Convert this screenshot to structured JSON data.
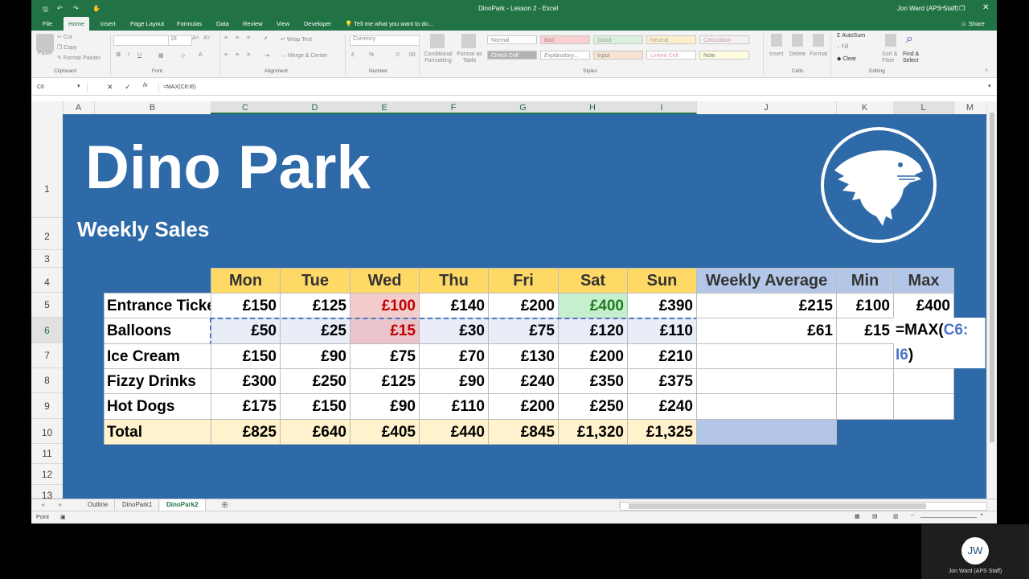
{
  "window": {
    "title": "DinoPark - Lesson 2 - Excel",
    "user": "Jon Ward (APS Staff)",
    "share_label": "Share"
  },
  "ribbon_tabs": [
    "File",
    "Home",
    "Insert",
    "Page Layout",
    "Formulas",
    "Data",
    "Review",
    "View",
    "Developer"
  ],
  "tell_me": "Tell me what you want to do...",
  "ribbon": {
    "clipboard": {
      "paste": "Paste",
      "cut": "Cut",
      "copy": "Copy",
      "format_painter": "Format Painter",
      "group": "Clipboard"
    },
    "font": {
      "size": "18",
      "group": "Font"
    },
    "alignment": {
      "wrap": "Wrap Text",
      "merge": "Merge & Center",
      "group": "Alignment"
    },
    "number": {
      "format": "Currency",
      "group": "Number"
    },
    "styles": {
      "conditional": "Conditional Formatting",
      "format_table": "Format as Table",
      "cells": [
        "Normal",
        "Bad",
        "Good",
        "Neutral",
        "Calculation",
        "Check Cell",
        "Explanatory...",
        "Input",
        "Linked Cell",
        "Note"
      ],
      "group": "Styles"
    },
    "cells": {
      "insert": "Insert",
      "delete": "Delete",
      "format": "Format",
      "group": "Cells"
    },
    "editing": {
      "autosum": "AutoSum",
      "fill": "Fill",
      "clear": "Clear",
      "sort": "Sort & Filter",
      "find": "Find & Select",
      "group": "Editing"
    }
  },
  "formula_bar": {
    "name_box": "C6",
    "formula": "=MAX(C6:I6)"
  },
  "columns": [
    "A",
    "B",
    "C",
    "D",
    "E",
    "F",
    "G",
    "H",
    "I",
    "J",
    "K",
    "L",
    "M"
  ],
  "rows": [
    "1",
    "2",
    "3",
    "4",
    "5",
    "6",
    "7",
    "8",
    "9",
    "10",
    "11",
    "12",
    "13"
  ],
  "sheet": {
    "title": "Dino Park",
    "subtitle": "Weekly Sales",
    "headers": [
      "Mon",
      "Tue",
      "Wed",
      "Thu",
      "Fri",
      "Sat",
      "Sun"
    ],
    "stat_headers": [
      "Weekly Average",
      "Min",
      "Max"
    ],
    "data_rows": [
      {
        "label": "Entrance Ticket",
        "values": [
          "£150",
          "£125",
          "£100",
          "£140",
          "£200",
          "£400",
          "£390"
        ],
        "avg": "£215",
        "min": "£100",
        "max": "£400"
      },
      {
        "label": "Balloons",
        "values": [
          "£50",
          "£25",
          "£15",
          "£30",
          "£75",
          "£120",
          "£110"
        ],
        "avg": "£61",
        "min": "£15",
        "max": ""
      },
      {
        "label": "Ice Cream",
        "values": [
          "£150",
          "£90",
          "£75",
          "£70",
          "£130",
          "£200",
          "£210"
        ],
        "avg": "",
        "min": "",
        "max": ""
      },
      {
        "label": "Fizzy Drinks",
        "values": [
          "£300",
          "£250",
          "£125",
          "£90",
          "£240",
          "£350",
          "£375"
        ],
        "avg": "",
        "min": "",
        "max": ""
      },
      {
        "label": "Hot Dogs",
        "values": [
          "£175",
          "£150",
          "£90",
          "£110",
          "£200",
          "£250",
          "£240"
        ],
        "avg": "",
        "min": "",
        "max": ""
      }
    ],
    "total": {
      "label": "Total",
      "values": [
        "£825",
        "£640",
        "£405",
        "£440",
        "£845",
        "£1,320",
        "£1,325"
      ]
    },
    "editing_formula": {
      "prefix": "=MAX(",
      "ref_a": "C6:",
      "ref_b": "I6",
      "suffix": ")"
    }
  },
  "sheet_tabs": [
    "Outline",
    "DinoPark1",
    "DinoPark2"
  ],
  "active_sheet": "DinoPark2",
  "status": {
    "mode": "Point"
  },
  "overlay": {
    "initials": "JW",
    "name": "Jon Ward (APS Staff)"
  },
  "colors": {
    "excel_green": "#217346",
    "sheet_blue": "#2e6aa8",
    "header_yellow": "#ffd966",
    "stat_header": "#b4c6e7"
  }
}
